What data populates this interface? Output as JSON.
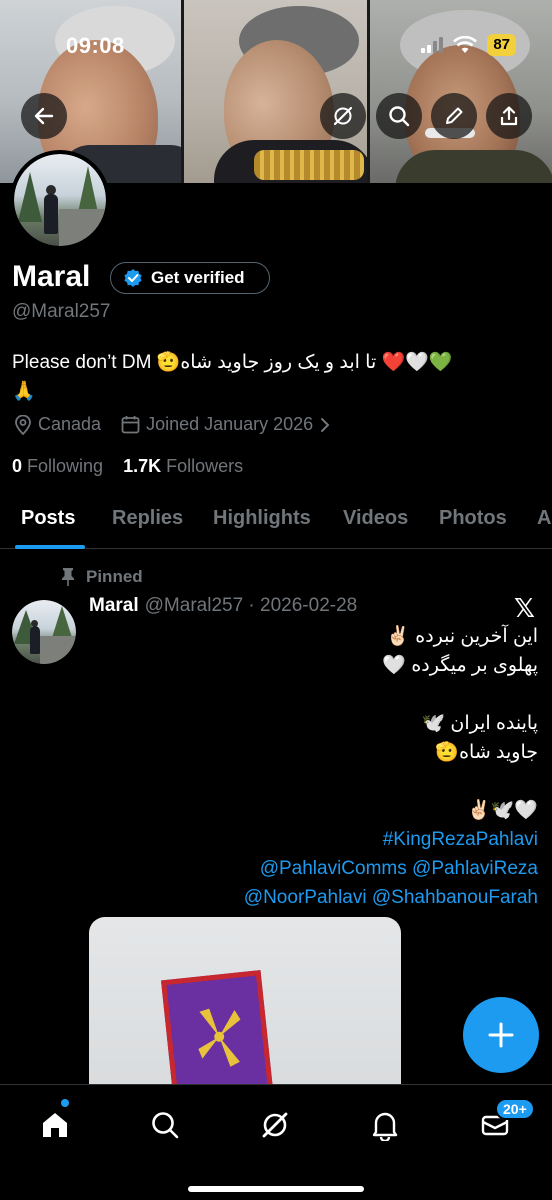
{
  "status_bar": {
    "time": "09:08",
    "battery": "87"
  },
  "profile": {
    "name": "Maral",
    "verify_label": "Get verified",
    "handle": "@Maral257",
    "bio_en": "Please don’t DM",
    "bio_fa": "تا ابد و یک روز جاوید شاه🫡",
    "bio_emojis": "❤️🤍💚",
    "bio_line2": "🙏",
    "location": "Canada",
    "joined": "Joined January 2026",
    "following_count": "0",
    "following_label": "Following",
    "followers_count": "1.7K",
    "followers_label": "Followers"
  },
  "tabs": [
    "Posts",
    "Replies",
    "Highlights",
    "Videos",
    "Photos",
    "A"
  ],
  "post": {
    "pinned_label": "Pinned",
    "name": "Maral",
    "handle": "@Maral257",
    "date": "· 2026-02-28",
    "lines": [
      "این آخرین نبرده ✌🏻",
      "پهلوی بر میگرده 🤍",
      "",
      "پاینده ایران 🕊️",
      "جاوید شاه🫡",
      "",
      "🤍🕊️✌🏻"
    ],
    "hashtag": "#KingRezaPahlavi",
    "mentions_line1": "@PahlaviComms @PahlaviReza",
    "mentions_line2": "@NoorPahlavi @ShahbanouFarah"
  },
  "bottom_nav": {
    "msg_badge": "20+"
  },
  "colors": {
    "accent": "#1d9bf0",
    "muted": "#71767b",
    "background": "#000000"
  }
}
